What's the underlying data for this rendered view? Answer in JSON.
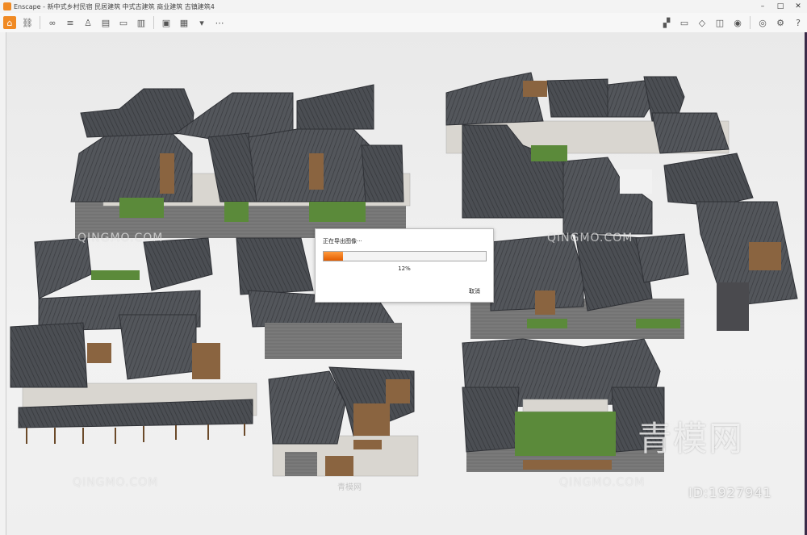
{
  "window": {
    "app_name": "Enscape",
    "title": "Enscape - 新中式乡村民宿 民居建筑 中式古建筑 商业建筑 古镇建筑4",
    "controls": {
      "minimize": "–",
      "maximize": "□",
      "close": "✕"
    }
  },
  "toolbar": {
    "left_icons": [
      "home-icon",
      "link-icon",
      "binoculars-icon",
      "sliders-icon",
      "person-icon",
      "pdf-icon",
      "file-icon",
      "clapboard-icon",
      "screenshot-icon",
      "batch-render-icon",
      "export-icon",
      "more-icon"
    ],
    "right_icons": [
      "map-icon",
      "monitor-icon",
      "cube-icon",
      "panorama-icon",
      "vr-headset-icon",
      "eye-icon",
      "settings-icon",
      "help-icon"
    ]
  },
  "export_dialog": {
    "title": "正在导出图像···",
    "progress": 0.12,
    "percent_label": "12%",
    "cancel_label": "取消"
  },
  "watermark": {
    "brand_latin": "QINGMO.COM",
    "brand_cn": "青模网",
    "brand_cn_small": "青模网",
    "id_label": "ID:1927941"
  },
  "colors": {
    "accent": "#f08a24",
    "progress_start": "#ff9a3c",
    "progress_end": "#e25c00",
    "roof": "#505359",
    "wall": "#d9d6d0"
  }
}
